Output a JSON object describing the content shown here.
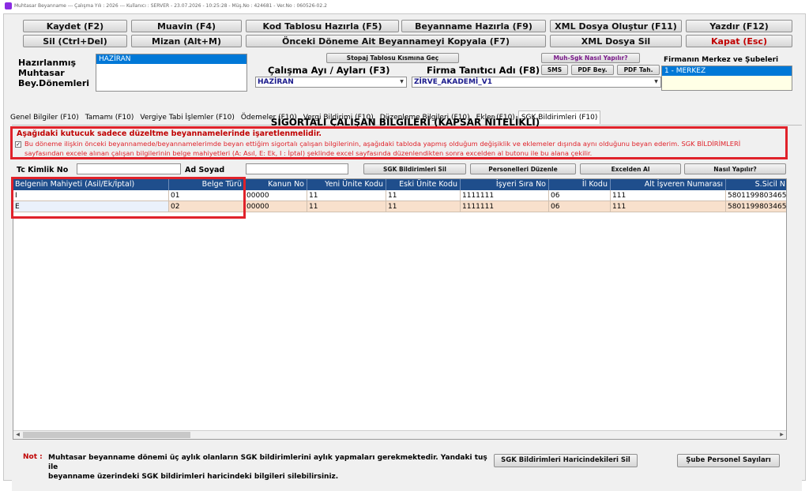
{
  "titlebar": "Muhtasar Beyanname   ---   Çalışma Yılı : 2026   ---   Kullanıcı : SERVER  -  23.07.2026  -  10:25:28  -  Müş.No : 424681  -  Ver.No : 060526-02.2",
  "toolbar": {
    "row1": [
      "Kaydet (F2)",
      "Muavin (F4)",
      "Kod Tablosu Hazırla (F5)",
      "Beyanname Hazırla (F9)",
      "XML Dosya Oluştur (F11)",
      "Yazdır (F12)"
    ],
    "row2": [
      "Sil (Ctrl+Del)",
      "Mizan (Alt+M)",
      "Önceki Döneme Ait Beyannameyi Kopyala (F7)",
      "XML Dosya Sil",
      "Kapat (Esc)"
    ]
  },
  "header": {
    "hazirlanmis_label": "Hazırlanmış\nMuhtasar\nBey.Dönemleri",
    "hazirlanmis_selected": "HAZİRAN",
    "stopaj_button": "Stopaj Tablosu Kısmına Geç",
    "muh_sgk_button": "Muh-Sgk Nasıl Yapılır?",
    "sms_button": "SMS",
    "pdf_bey_button": "PDF Bey.",
    "pdf_tah_button": "PDF Tah.",
    "calisma_ayi_label": "Çalışma Ayı / Ayları (F3)",
    "calisma_ayi_value": "HAZİRAN",
    "firma_tanitici_label": "Firma Tanıtıcı Adı (F8)",
    "firma_tanitici_value": "ZİRVE_AKADEMİ_V1",
    "merkez_label": "Firmanın Merkez ve Şubeleri",
    "merkez_selected": "1 - MERKEZ"
  },
  "tabs": [
    "Genel Bilgiler (F10)",
    "Tamamı (F10)",
    "Vergiye Tabi İşlemler (F10)",
    "Ödemeler (F10)",
    "Vergi Bildirimi (F10)",
    "Düzenleme Bilgileri (F10)",
    "Ekler (F10)",
    "SGK Bildirimleri (F10)"
  ],
  "active_tab": 7,
  "section_title": "SİGORTALI ÇALIŞAN BİLGİLERİ (KAPSAR NİTELİKLİ)",
  "warning": {
    "title": "Aşağıdaki kutucuk sadece düzeltme beyannamelerinde işaretlenmelidir.",
    "line1": "Bu döneme ilişkin önceki beyannamede/beyannamelerimde beyan ettiğim sigortalı çalışan bilgilerinin, aşağıdaki tabloda yapmış olduğum değişiklik ve eklemeler dışında aynı olduğunu beyan ederim. SGK BİLDİRİMLERİ",
    "line2": "sayfasından excele alınan çalışan bilgilerinin belge mahiyetleri (A: Asıl, E: Ek, I : İptal) şeklinde excel sayfasında düzenlendikten sonra excelden al butonu ile bu alana çekilir.",
    "checked": true
  },
  "filters": {
    "tc_label": "Tc Kimlik No",
    "tc_value": "",
    "ad_label": "Ad Soyad",
    "ad_value": ""
  },
  "action_buttons": [
    "SGK Bildirimleri Sil",
    "Personelleri Düzenle",
    "Excelden Al",
    "Nasıl Yapılır?"
  ],
  "table": {
    "columns": [
      "Belgenin Mahiyeti (Asil/Ek/İptal)",
      "Belge Türü",
      "Kanun No",
      "Yeni Ünite Kodu",
      "Eski Ünite Kodu",
      "İşyeri Sıra No",
      "İl Kodu",
      "Alt İşveren Numarası",
      "S.Sicil N"
    ],
    "rows": [
      [
        "I",
        "01",
        "00000",
        "11",
        "11",
        "1111111",
        "06",
        "111",
        "5801199803465"
      ],
      [
        "E",
        "02",
        "00000",
        "11",
        "11",
        "1111111",
        "06",
        "111",
        "5801199803465"
      ]
    ]
  },
  "footer": {
    "note_label": "Not :",
    "note_text_1": "Muhtasar beyanname dönemi üç aylık olanların SGK bildirimlerini aylık yapmaları gerekmektedir. Yandaki tuş ile",
    "note_text_2": "beyanname üzerindeki SGK bildirimleri haricindeki bilgileri silebilirsiniz.",
    "btn_sgk_haric": "SGK Bildirimleri Haricindekileri Sil",
    "btn_sube": "Şube Personel Sayıları"
  },
  "colors": {
    "accent_red": "#e0222a",
    "header_blue": "#1f4e8c",
    "selection_blue": "#0078d7",
    "row_alt": "#f8e0cc"
  }
}
